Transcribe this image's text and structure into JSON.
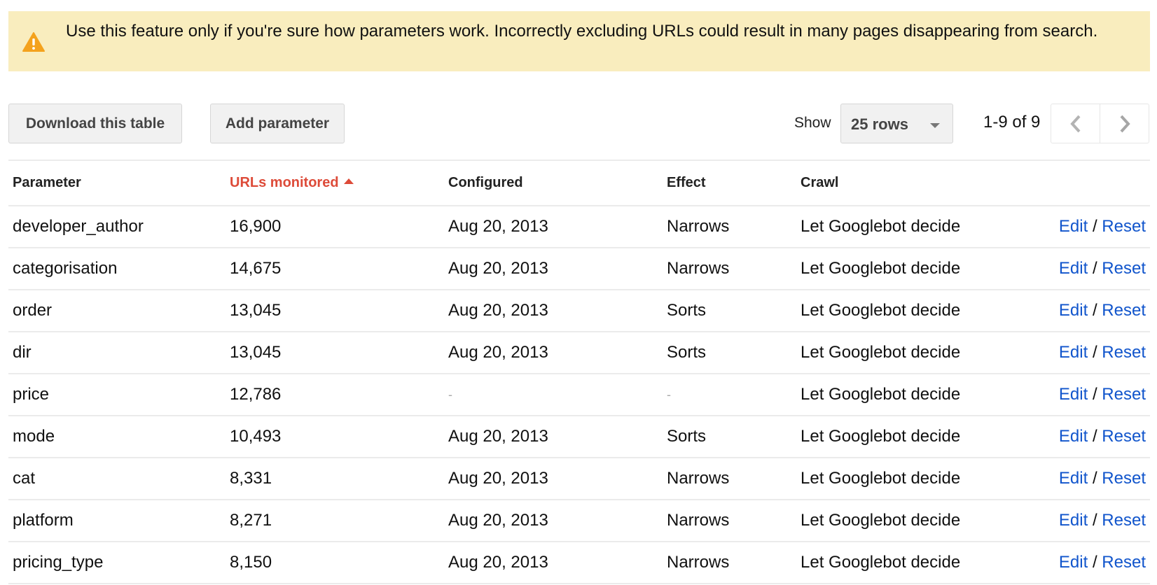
{
  "warning": {
    "icon": "warning-triangle-icon",
    "message": "Use this feature only if you're sure how parameters work. Incorrectly excluding URLs could result in many pages disappearing from search."
  },
  "toolbar": {
    "download_label": "Download this table",
    "add_label": "Add parameter",
    "show_label": "Show",
    "rows_selected": "25 rows",
    "range": "1-9 of 9",
    "prev_icon": "chevron-left-icon",
    "next_icon": "chevron-right-icon"
  },
  "table": {
    "columns": [
      "Parameter",
      "URLs monitored",
      "Configured",
      "Effect",
      "Crawl",
      ""
    ],
    "sorted_column": "URLs monitored",
    "sort_direction": "ascending",
    "edit_label": "Edit",
    "separator": "/",
    "reset_label": "Reset",
    "rows": [
      {
        "parameter": "developer_author",
        "urls": "16,900",
        "configured": "Aug 20, 2013",
        "effect": "Narrows",
        "crawl": "Let Googlebot decide"
      },
      {
        "parameter": "categorisation",
        "urls": "14,675",
        "configured": "Aug 20, 2013",
        "effect": "Narrows",
        "crawl": "Let Googlebot decide"
      },
      {
        "parameter": "order",
        "urls": "13,045",
        "configured": "Aug 20, 2013",
        "effect": "Sorts",
        "crawl": "Let Googlebot decide"
      },
      {
        "parameter": "dir",
        "urls": "13,045",
        "configured": "Aug 20, 2013",
        "effect": "Sorts",
        "crawl": "Let Googlebot decide"
      },
      {
        "parameter": "price",
        "urls": "12,786",
        "configured": "-",
        "effect": "-",
        "crawl": "Let Googlebot decide"
      },
      {
        "parameter": "mode",
        "urls": "10,493",
        "configured": "Aug 20, 2013",
        "effect": "Sorts",
        "crawl": "Let Googlebot decide"
      },
      {
        "parameter": "cat",
        "urls": "8,331",
        "configured": "Aug 20, 2013",
        "effect": "Narrows",
        "crawl": "Let Googlebot decide"
      },
      {
        "parameter": "platform",
        "urls": "8,271",
        "configured": "Aug 20, 2013",
        "effect": "Narrows",
        "crawl": "Let Googlebot decide"
      },
      {
        "parameter": "pricing_type",
        "urls": "8,150",
        "configured": "Aug 20, 2013",
        "effect": "Narrows",
        "crawl": "Let Googlebot decide"
      }
    ]
  },
  "colors": {
    "warning_bg": "#f9edbe",
    "warning_icon": "#f4a21d",
    "sorted_header": "#dd4b39",
    "link": "#1155cc"
  }
}
